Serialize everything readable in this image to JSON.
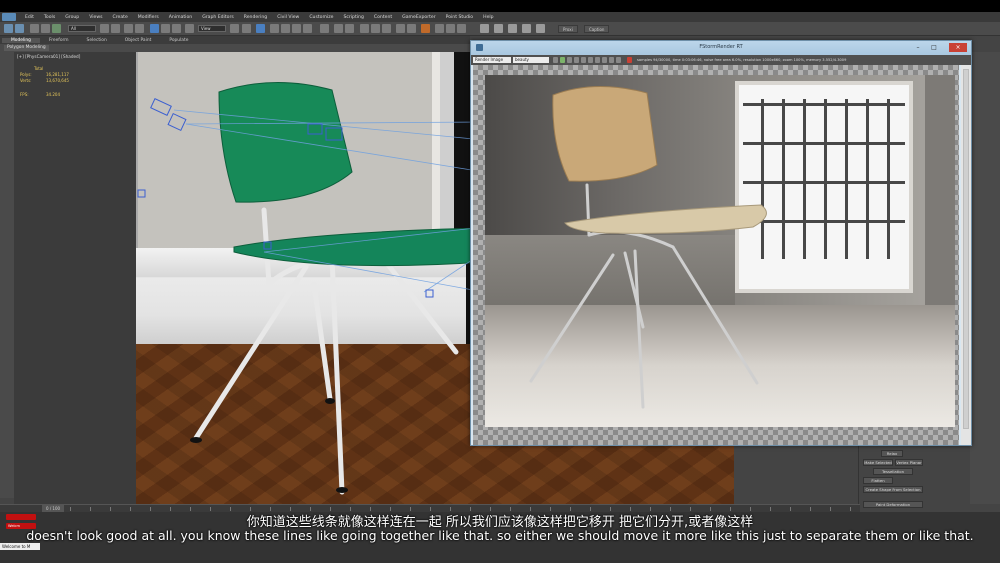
{
  "menubar": {
    "items": [
      "Edit",
      "Tools",
      "Group",
      "Views",
      "Create",
      "Modifiers",
      "Animation",
      "Graph Editors",
      "Rendering",
      "Civil View",
      "Customize",
      "Scripting",
      "Content",
      "GameExporter",
      "Point Studio",
      "Help"
    ]
  },
  "toolbar": {
    "selection_filter": "All",
    "view_dropdown": "View",
    "right_button_1": "Proxi",
    "right_button_2": "Caption"
  },
  "ribbon": {
    "tabs": [
      "Modeling",
      "Freeform",
      "Selection",
      "Object Paint",
      "Populate"
    ],
    "sub_label": "Polygon Modeling"
  },
  "viewport": {
    "label": "[+] [PhysCamera01] [Shaded]",
    "stats": {
      "total_label": "Total",
      "polys_label": "Polys:",
      "polys_value": "16,281,117",
      "verts_label": "Verts:",
      "verts_value": "13,670,645",
      "fps_label": "FPS:",
      "fps_value": "34.204"
    }
  },
  "render_window": {
    "title": "FStormRender RT",
    "dropdown_1": "Render Image",
    "dropdown_2": "beauty",
    "info": "samples 94/30000,  time 0:03:06:46,  noise free area 6.0%,  resolution 1000x660,  zoom 100%,  memory 3.552/4.3009"
  },
  "timeline": {
    "frame_label": "0 / 100"
  },
  "command_panel": {
    "buttons": [
      "Relax",
      "Make Selected",
      "Vertex Planar",
      "Tessellation",
      "Flatten",
      "Create Shape From Selection",
      "Paint Deformation"
    ]
  },
  "status": {
    "red_button": "Welcm",
    "welcome": "Welcome to M"
  },
  "subtitles": {
    "chinese": "你知道这些线条就像这样连在一起 所以我们应该像这样把它移开 把它们分开,或者像这样",
    "english": "doesn't look good at all. you know these lines like going together like that. so either we should move it more like this just to separate them or like that."
  },
  "colors": {
    "chair_seat_viewport": "#178a58",
    "render_titlebar": "#b3cfe4",
    "close_button": "#c94135",
    "stats_text": "#e6c75a",
    "floor_wood": "#5a3116"
  }
}
